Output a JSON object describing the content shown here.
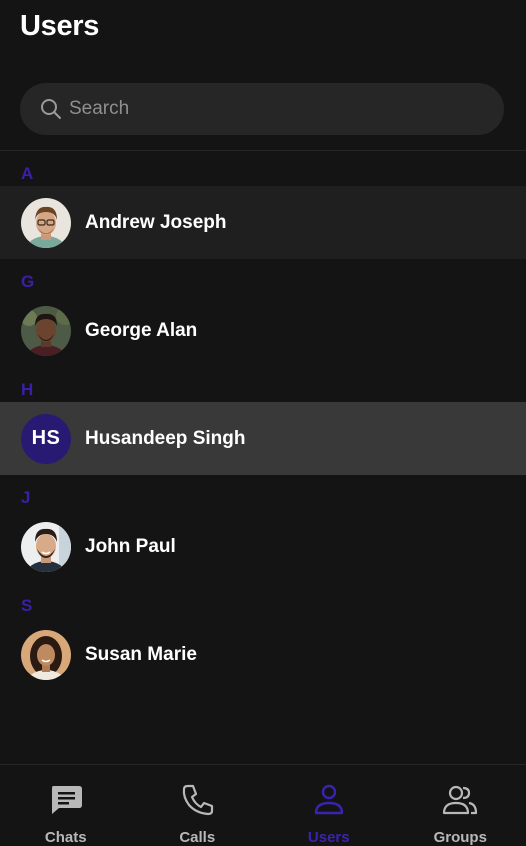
{
  "header": {
    "title": "Users"
  },
  "search": {
    "placeholder": "Search",
    "value": ""
  },
  "colors": {
    "background": "#141414",
    "accent": "#3b1fa8",
    "selected_row": "#393939",
    "hover_row": "#1f1f1f",
    "initials_avatar": "#281a73"
  },
  "sections": [
    {
      "letter": "A",
      "users": [
        {
          "name": "Andrew Joseph",
          "avatar": "photo",
          "state": "hover"
        }
      ]
    },
    {
      "letter": "G",
      "users": [
        {
          "name": "George Alan",
          "avatar": "photo",
          "state": "normal"
        }
      ]
    },
    {
      "letter": "H",
      "users": [
        {
          "name": "Husandeep Singh",
          "avatar": "initials",
          "initials": "HS",
          "state": "selected"
        }
      ]
    },
    {
      "letter": "J",
      "users": [
        {
          "name": "John Paul",
          "avatar": "photo",
          "state": "normal"
        }
      ]
    },
    {
      "letter": "S",
      "users": [
        {
          "name": "Susan Marie",
          "avatar": "photo",
          "state": "normal"
        }
      ]
    }
  ],
  "bottom_nav": {
    "active": "Users",
    "tabs": [
      {
        "label": "Chats",
        "icon": "chat-bubble-icon"
      },
      {
        "label": "Calls",
        "icon": "phone-icon"
      },
      {
        "label": "Users",
        "icon": "user-icon"
      },
      {
        "label": "Groups",
        "icon": "groups-icon"
      }
    ]
  }
}
